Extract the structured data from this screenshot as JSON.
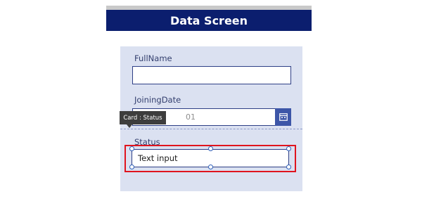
{
  "screen": {
    "title": "Data Screen"
  },
  "form": {
    "fullname": {
      "label": "FullName",
      "value": ""
    },
    "joining_date": {
      "label": "JoiningDate",
      "value_visible": "01"
    },
    "status": {
      "label": "Status",
      "value": "Text input"
    }
  },
  "tooltip": {
    "text": "Card : Status"
  },
  "colors": {
    "header_bg": "#0b1e6e",
    "form_bg": "#dbe1f1",
    "selection": "#e0141e",
    "field_border": "#2e3f86"
  },
  "icons": {
    "calendar": "calendar-icon"
  }
}
